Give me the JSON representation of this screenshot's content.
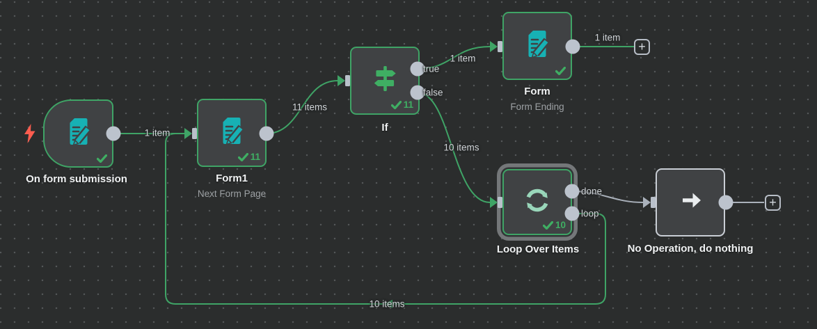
{
  "app": {
    "name": "workflow-canvas"
  },
  "colors": {
    "background": "#2b2d2d",
    "node_fill": "#404244",
    "green": "#3fa466",
    "teal": "#17b1b4",
    "mint": "#99d6ba",
    "red_bolt": "#ff5d4f",
    "gray_connector": "#bcc3cd",
    "gray_edge": "#aab1bb",
    "node_border_gray": "#c9ced5",
    "check_green": "#3fae63"
  },
  "nodes": {
    "trigger": {
      "label": "On form submission"
    },
    "form1": {
      "label": "Form1",
      "subtitle": "Next Form Page",
      "count": "11"
    },
    "if": {
      "label": "If",
      "count": "11"
    },
    "form": {
      "label": "Form",
      "subtitle": "Form Ending"
    },
    "loop": {
      "label": "Loop Over Items",
      "count": "10"
    },
    "noop": {
      "label": "No Operation, do nothing"
    }
  },
  "ports": {
    "true": "true",
    "false": "false",
    "done": "done",
    "loop": "loop"
  },
  "edges": {
    "trigger_form1": "1 item",
    "form1_if": "11 items",
    "if_form": "1 item",
    "if_loop": "10 items",
    "form_plus": "1 item",
    "loop_back": "10 items"
  },
  "icons": {
    "plus": "+"
  }
}
